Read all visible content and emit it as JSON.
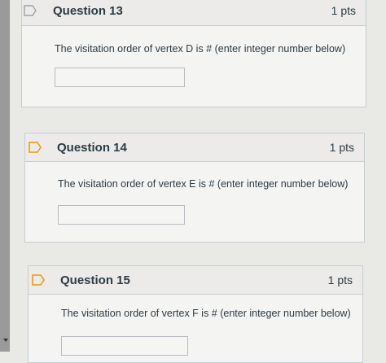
{
  "questions": [
    {
      "title": "Question 13",
      "points": "1 pts",
      "prompt": "The visitation order of vertex D is # (enter integer number below)",
      "answer_value": ""
    },
    {
      "title": "Question 14",
      "points": "1 pts",
      "prompt": "The visitation order of vertex E is # (enter integer number below)",
      "answer_value": ""
    },
    {
      "title": "Question 15",
      "points": "1 pts",
      "prompt": "The visitation order of vertex F is # (enter integer number below)",
      "answer_value": ""
    }
  ],
  "icons": {
    "flag": "flag-question-icon"
  },
  "colors": {
    "flag_accent": "#f0a000",
    "text": "#2d3b45",
    "border": "#c7cdd1"
  }
}
